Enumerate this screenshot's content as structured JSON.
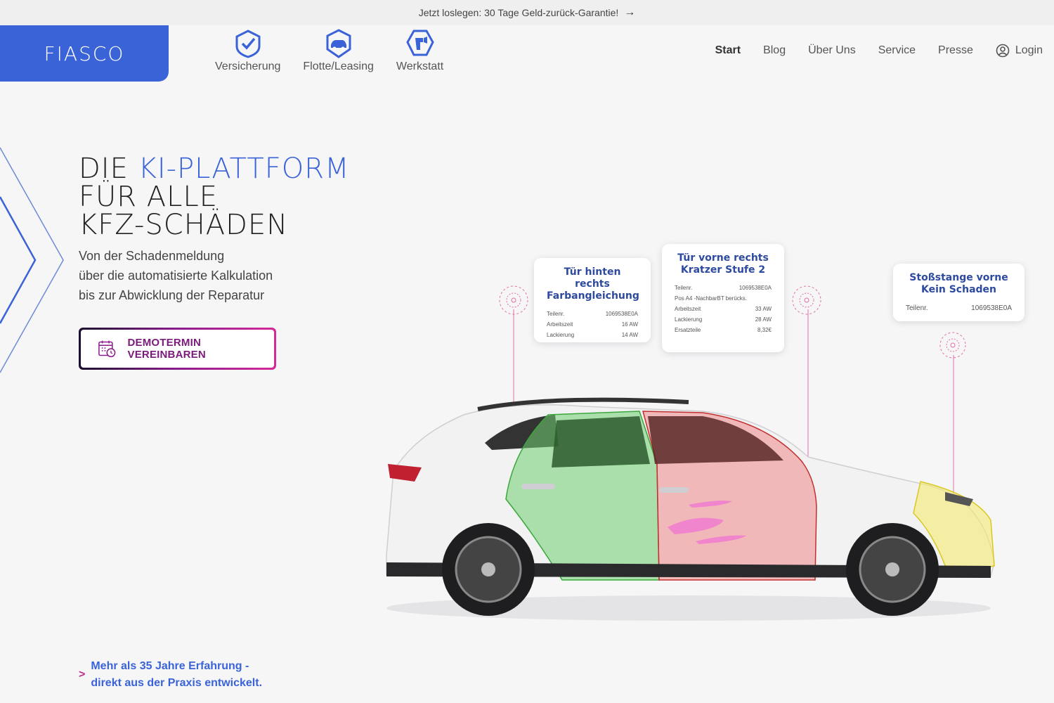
{
  "promo": {
    "text": "Jetzt loslegen: 30 Tage Geld-zurück-Garantie!",
    "arrow_icon": "arrow-right-icon"
  },
  "brand": {
    "logo_text": "FIASCO",
    "accent_color": "#3a63d8"
  },
  "categories": [
    {
      "label": "Versicherung",
      "icon": "shield-check-icon"
    },
    {
      "label": "Flotte/Leasing",
      "icon": "fleet-car-icon"
    },
    {
      "label": "Werkstatt",
      "icon": "workshop-icon"
    }
  ],
  "nav": {
    "start": "Start",
    "blog": "Blog",
    "about": "Über Uns",
    "service": "Service",
    "press": "Presse",
    "login": "Login"
  },
  "hero": {
    "title_part1": "DIE ",
    "title_accent": "KI-PLATTFORM",
    "title_line2": "FÜR ALLE",
    "title_line3": "KFZ-SCHÄDEN",
    "sub1": "Von der Schadenmeldung",
    "sub2": "über die automatisierte Kalkulation",
    "sub3": "bis zur Abwicklung der Reparatur",
    "cta": "DEMOTERMIN VEREINBAREN"
  },
  "claim": {
    "line1": "Mehr als 35 Jahre Erfahrung -",
    "line2": "direkt aus der Praxis entwickelt."
  },
  "cards": {
    "rear_door": {
      "title1": "Tür hinten rechts",
      "title2": "Farbangleichung",
      "rows": [
        {
          "k": "Teilenr.",
          "v": "1069538E0A"
        },
        {
          "k": "Arbeitszeit",
          "v": "16 AW"
        },
        {
          "k": "Lackierung",
          "v": "14 AW"
        }
      ]
    },
    "front_door": {
      "title1": "Tür vorne rechts",
      "title2": "Kratzer Stufe 2",
      "rows": [
        {
          "k": "Teilenr.",
          "v": "1069538E0A"
        },
        {
          "k": "Pos A4 -NachbarBT berücks.",
          "v": ""
        },
        {
          "k": "Arbeitszeit",
          "v": "33 AW"
        },
        {
          "k": "Lackierung",
          "v": "28 AW"
        },
        {
          "k": "Ersatzteile",
          "v": "8,32€"
        }
      ]
    },
    "bumper": {
      "title1": "Stoßstange vorne",
      "title2": "Kein Schaden",
      "rows": [
        {
          "k": "Teilenr.",
          "v": "1069538E0A"
        }
      ]
    }
  }
}
